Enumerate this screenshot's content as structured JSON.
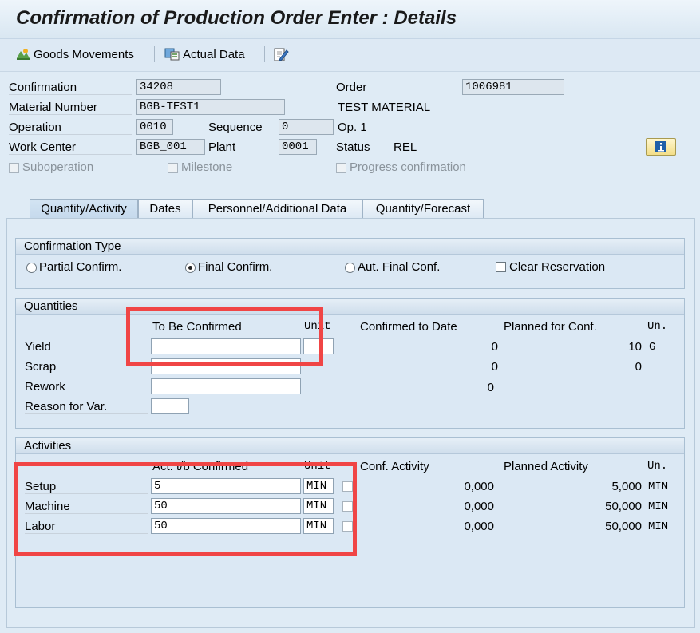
{
  "title": "Confirmation of Production Order Enter : Details",
  "toolbar": {
    "goods_movements": "Goods Movements",
    "actual_data": "Actual Data"
  },
  "header": {
    "confirmation_label": "Confirmation",
    "confirmation_value": "34208",
    "order_label": "Order",
    "order_value": "1006981",
    "material_label": "Material Number",
    "material_value": "BGB-TEST1",
    "material_desc": "TEST MATERIAL",
    "operation_label": "Operation",
    "operation_value": "0010",
    "sequence_label": "Sequence",
    "sequence_value": "0",
    "op_desc": "Op. 1",
    "workcenter_label": "Work Center",
    "workcenter_value": "BGB_001",
    "plant_label": "Plant",
    "plant_value": "0001",
    "status_label": "Status",
    "status_value": "REL",
    "suboperation": "Suboperation",
    "milestone": "Milestone",
    "progress": "Progress confirmation"
  },
  "tabs": [
    "Quantity/Activity",
    "Dates",
    "Personnel/Additional Data",
    "Quantity/Forecast"
  ],
  "confirmation_type": {
    "title": "Confirmation Type",
    "partial": "Partial Confirm.",
    "final": "Final Confirm.",
    "aut_final": "Aut. Final Conf.",
    "clear_reservation": "Clear Reservation"
  },
  "quantities": {
    "title": "Quantities",
    "col_to_be_confirmed": "To Be Confirmed",
    "col_unit": "Unit",
    "col_confirmed_to_date": "Confirmed to Date",
    "col_planned": "Planned for Conf.",
    "col_un": "Un.",
    "yield_label": "Yield",
    "yield_confirmed": "0",
    "yield_planned": "10",
    "yield_unit": "G",
    "scrap_label": "Scrap",
    "scrap_confirmed": "0",
    "scrap_planned": "0",
    "rework_label": "Rework",
    "rework_confirmed": "0",
    "reason_label": "Reason for Var."
  },
  "activities": {
    "title": "Activities",
    "col_to_be_confirmed": "Act. t/b Confirmed",
    "col_unit": "Unit",
    "col_conf_activity": "Conf. Activity",
    "col_planned": "Planned Activity",
    "col_un": "Un.",
    "rows": [
      {
        "label": "Setup",
        "value": "5",
        "unit": "MIN",
        "conf": "0,000",
        "planned": "5,000",
        "un": "MIN"
      },
      {
        "label": "Machine",
        "value": "50",
        "unit": "MIN",
        "conf": "0,000",
        "planned": "50,000",
        "un": "MIN"
      },
      {
        "label": "Labor",
        "value": "50",
        "unit": "MIN",
        "conf": "0,000",
        "planned": "50,000",
        "un": "MIN"
      }
    ]
  },
  "colors": {
    "highlight": "#f04545",
    "background": "#dfebf5"
  }
}
